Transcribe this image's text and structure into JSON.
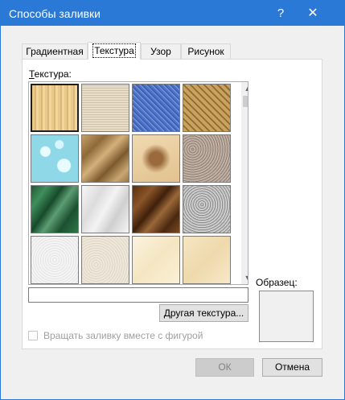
{
  "window": {
    "title": "Способы заливки",
    "help_glyph": "?",
    "close_glyph": "✕"
  },
  "tabs": [
    {
      "label": "Градиентная",
      "active": false
    },
    {
      "label": "Текстура",
      "active": true
    },
    {
      "label": "Узор",
      "active": false
    },
    {
      "label": "Рисунок",
      "active": false
    }
  ],
  "texture": {
    "label_accel": "Т",
    "label_rest": "екстура:",
    "textures": [
      "papyrus",
      "canvas",
      "denim",
      "woven-mat",
      "water-droplets",
      "paper-bag",
      "fish-fossil",
      "sand",
      "green-marble",
      "white-marble",
      "brown-marble",
      "granite",
      "newsprint",
      "recycled-paper",
      "parchment",
      "stationery"
    ],
    "selected_index": 0,
    "name_value": "",
    "other_button": "Другая текстура...",
    "scroll_up_icon": "▲",
    "scroll_down_icon": "▼"
  },
  "preview": {
    "label": "Образец:"
  },
  "rotate": {
    "label": "Вращать заливку вместе с фигурой",
    "checked": false,
    "enabled": false
  },
  "footer": {
    "ok": "ОК",
    "cancel": "Отмена"
  },
  "colors": {
    "titlebar": "#2b79d6",
    "dialog_bg": "#f0f0f0",
    "disabled_text": "#a0a0a0"
  }
}
